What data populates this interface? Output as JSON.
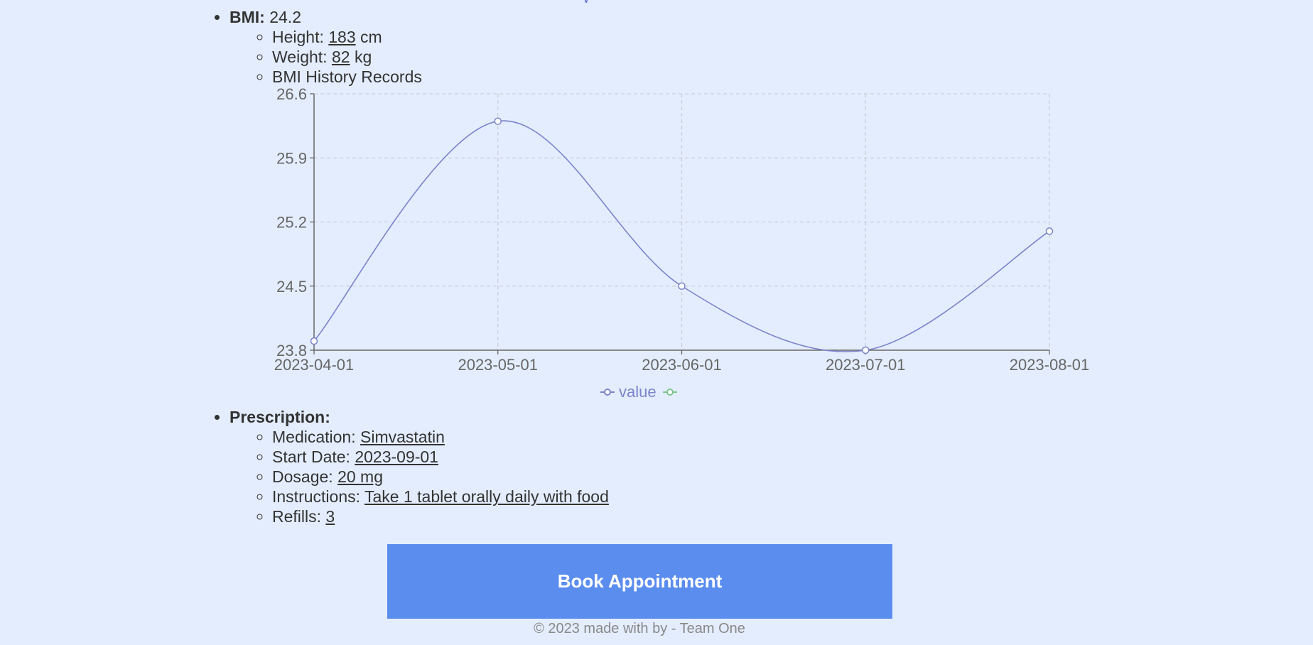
{
  "bmi": {
    "label": "BMI:",
    "value": "24.2",
    "height_label": "Height:",
    "height_value": "183",
    "height_unit": "cm",
    "weight_label": "Weight:",
    "weight_value": "82",
    "weight_unit": "kg",
    "history_label": "BMI History Records"
  },
  "chart_data": {
    "type": "line",
    "x": [
      "2023-04-01",
      "2023-05-01",
      "2023-06-01",
      "2023-07-01",
      "2023-08-01"
    ],
    "series": [
      {
        "name": "value",
        "values": [
          23.9,
          26.3,
          24.5,
          23.8,
          25.1
        ],
        "color": "#7b84cc"
      },
      {
        "name": "",
        "values": [],
        "color": "#7cc68f"
      }
    ],
    "y_ticks": [
      "23.8",
      "24.5",
      "25.2",
      "25.9",
      "26.6"
    ],
    "ylim": [
      23.8,
      26.6
    ],
    "grid": true,
    "legend": "bottom-center"
  },
  "prescription": {
    "label": "Prescription:",
    "medication_label": "Medication:",
    "medication_value": "Simvastatin",
    "start_label": "Start Date:",
    "start_value": "2023-09-01",
    "dosage_label": "Dosage:",
    "dosage_value": "20 mg",
    "instructions_label": "Instructions:",
    "instructions_value": "Take 1 tablet orally daily with food",
    "refills_label": "Refills:",
    "refills_value": "3"
  },
  "actions": {
    "book_label": "Book Appointment"
  },
  "footer": {
    "text": "© 2023 made with by - Team One"
  },
  "colors": {
    "background": "#e4edfd",
    "button": "#5b8def",
    "series_line": "#7b84cc",
    "legend_secondary": "#7cc68f"
  }
}
